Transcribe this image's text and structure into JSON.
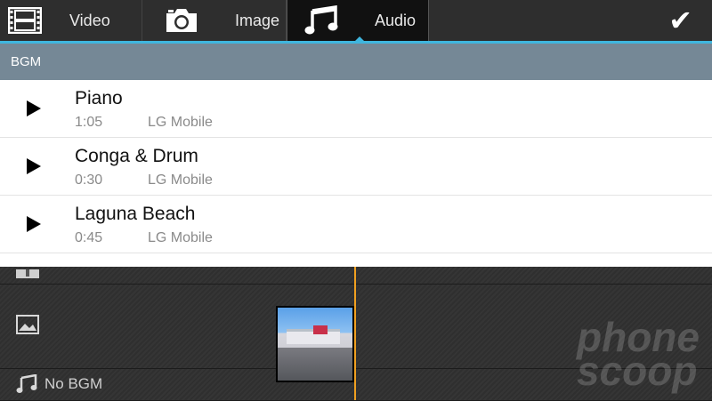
{
  "tabs": [
    {
      "label": "Video",
      "icon": "film-icon"
    },
    {
      "label": "Image",
      "icon": "camera-icon"
    },
    {
      "label": "Audio",
      "icon": "music-note-icon",
      "selected": true
    }
  ],
  "toolbar": {
    "confirm_icon": "checkmark-icon"
  },
  "section": {
    "title": "BGM"
  },
  "tracks": [
    {
      "title": "Piano",
      "duration": "1:05",
      "artist": "LG Mobile"
    },
    {
      "title": "Conga & Drum",
      "duration": "0:30",
      "artist": "LG Mobile"
    },
    {
      "title": "Laguna Beach",
      "duration": "0:45",
      "artist": "LG Mobile"
    }
  ],
  "timeline": {
    "bgm_label": "No BGM"
  },
  "watermark": {
    "line1": "phone",
    "line2": "scoop"
  },
  "colors": {
    "accent": "#3fb6de",
    "header": "#758896",
    "playhead": "#f0a020"
  }
}
